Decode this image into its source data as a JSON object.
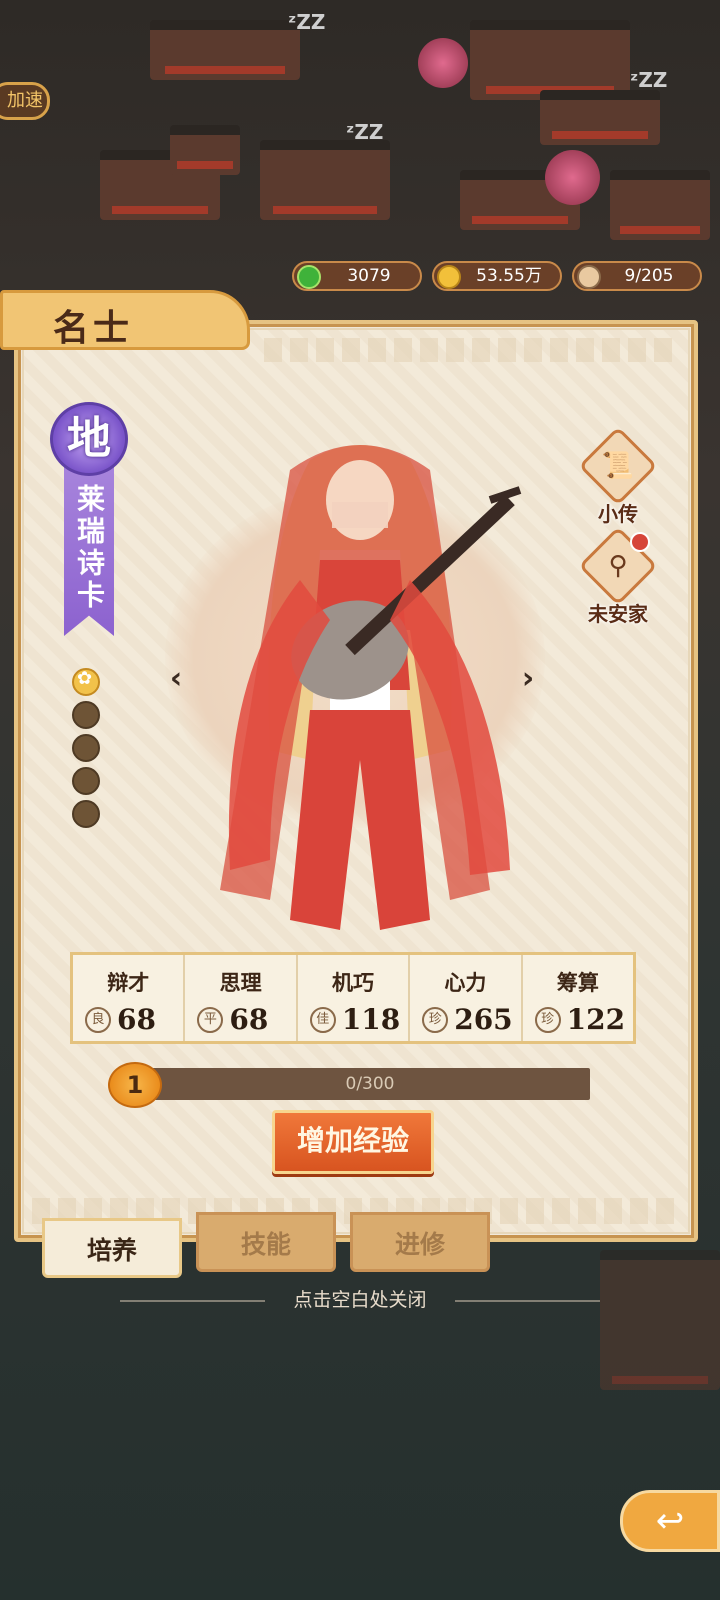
{
  "header": {
    "speed_button": "加速",
    "resources": [
      {
        "icon": "jade-coin-icon",
        "value": "3079"
      },
      {
        "icon": "copper-coin-icon",
        "value": "53.55万"
      },
      {
        "icon": "population-icon",
        "value": "9/205"
      }
    ]
  },
  "panel": {
    "title": "名士",
    "rank": "地",
    "character_name": "莱瑞诗卡",
    "star_dots": [
      true,
      false,
      false,
      false,
      false
    ],
    "side_buttons": [
      {
        "label": "小传",
        "icon": "scroll-icon"
      },
      {
        "label": "未安家",
        "icon": "home-figure-icon",
        "has_alert": true
      }
    ],
    "stats": [
      {
        "name": "辩才",
        "grade": "良",
        "value": "68"
      },
      {
        "name": "思理",
        "grade": "平",
        "value": "68"
      },
      {
        "name": "机巧",
        "grade": "佳",
        "value": "118"
      },
      {
        "name": "心力",
        "grade": "珍",
        "value": "265"
      },
      {
        "name": "筹算",
        "grade": "珍",
        "value": "122"
      }
    ],
    "level": "1",
    "exp_text": "0/300",
    "exp_fraction": 0,
    "add_exp_button": "增加经验"
  },
  "tabs": [
    {
      "label": "培养",
      "active": true
    },
    {
      "label": "技能",
      "active": false
    },
    {
      "label": "进修",
      "active": false
    }
  ],
  "close_hint": "点击空白处关闭",
  "colors": {
    "accent": "#e98a1a",
    "rank_purple": "#8c62cf",
    "panel_bg": "#f1e8d8"
  }
}
